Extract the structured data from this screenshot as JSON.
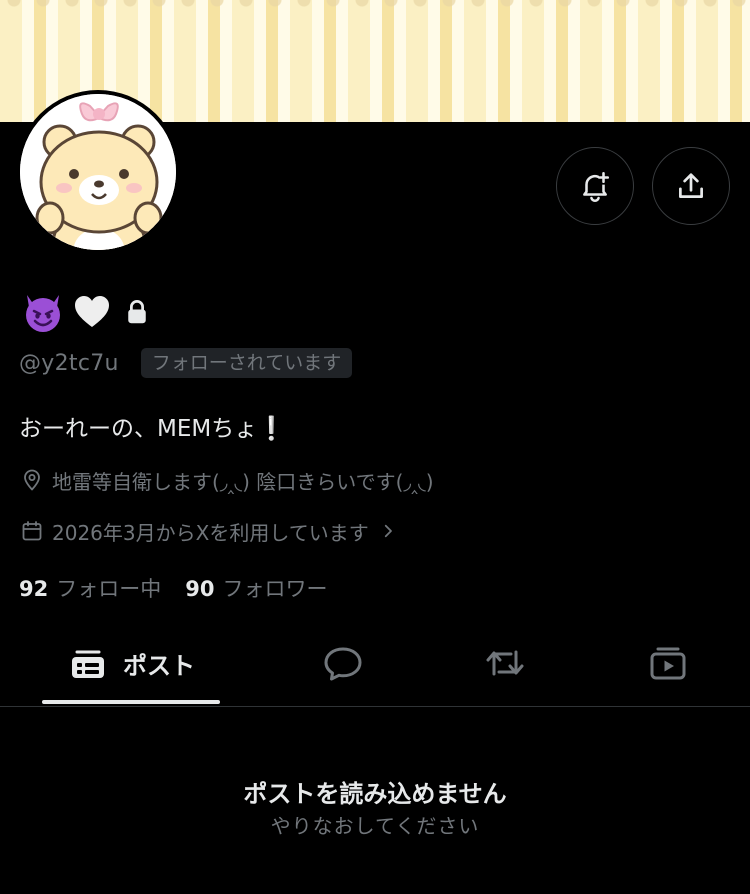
{
  "profile": {
    "name_emojis": [
      "😈",
      "🤍"
    ],
    "handle": "@y2tc7u",
    "follows_you": "フォローされています",
    "bio": "おーれーの、MEMちょ❕",
    "location": "地雷等自衛します(◞‸◟) 陰口きらいです(◞‸◟)",
    "joined": "2026年3月からXを利用しています",
    "following_count": "92",
    "following_label": "フォロー中",
    "followers_count": "90",
    "followers_label": "フォロワー"
  },
  "tabs": {
    "posts_label": "ポスト"
  },
  "empty_state": {
    "title": "ポストを読み込めません",
    "subtitle": "やりなおしてください"
  },
  "icons": {
    "notify": "bell-plus-icon",
    "share": "share-icon",
    "lock": "lock-icon",
    "location": "location-pin-icon",
    "calendar": "calendar-icon",
    "chevron": "chevron-right-icon",
    "tab_posts": "posts-icon",
    "tab_replies": "reply-bubble-icon",
    "tab_reposts": "repost-icon",
    "tab_media": "media-icon"
  },
  "colors": {
    "background": "#000000",
    "text_primary": "#e7e9ea",
    "text_secondary": "#71767b",
    "border": "#2f3336"
  }
}
